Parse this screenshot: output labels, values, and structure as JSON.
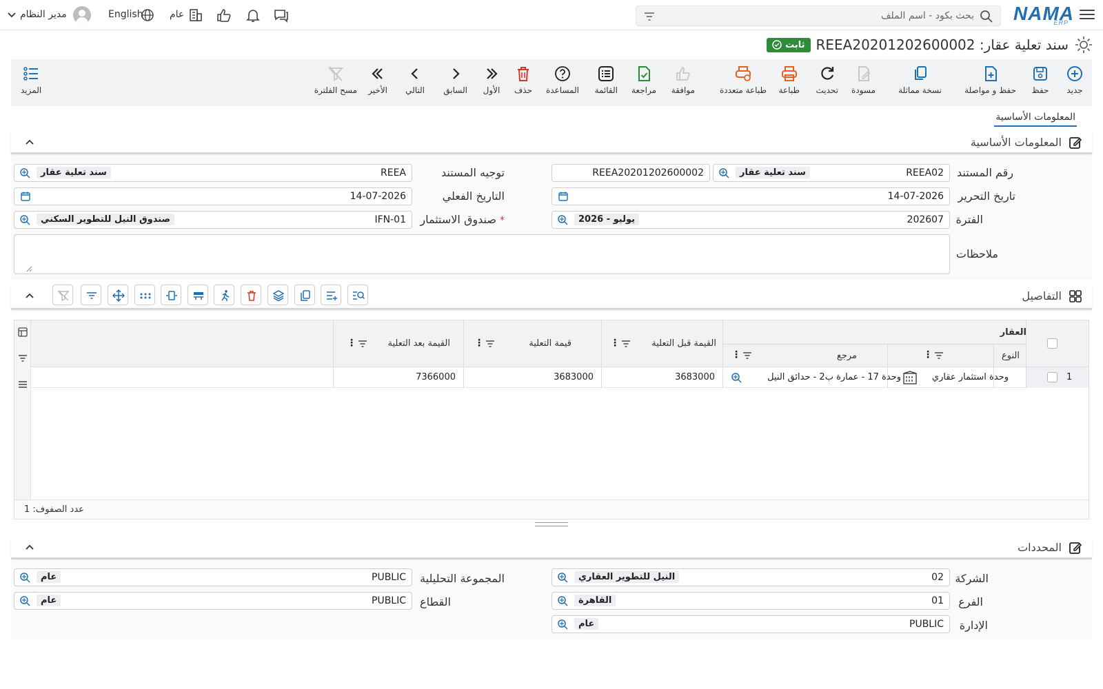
{
  "topbar": {
    "logo": "NAMA",
    "logo_sub": "ERP",
    "search_placeholder": "بحث بكود - اسم الملف",
    "user": "مدير النظام",
    "language": "English",
    "branch": "عام"
  },
  "header": {
    "title": "سند تعلية عقار: REEA20201202600002",
    "status": "ثابت"
  },
  "toolbar": {
    "new": "جديد",
    "save": "حفظ",
    "save_continue": "حفظ و مواصلة",
    "duplicate": "نسخة مماثلة",
    "draft": "مسودة",
    "refresh": "تحديث",
    "print": "طباعة",
    "multi_print": "طباعة متعددة",
    "approve": "موافقة",
    "review": "مراجعة",
    "list": "القائمة",
    "help": "المساعدة",
    "delete": "حذف",
    "first": "الأول",
    "previous": "السابق",
    "next": "التالي",
    "last": "الأخير",
    "clear_filter": "مسح الفلترة",
    "more": "المزيد"
  },
  "tabs": [
    "المعلومات الأساسية"
  ],
  "basic": {
    "section_title": "المعلومات الأساسية",
    "doc_number_label": "رقم المستند",
    "doc_number_code": "REEA02",
    "doc_number_tag": "سند تعلية عقار",
    "doc_number_full": "REEA20201202600002",
    "direction_label": "توجيه المستند",
    "direction_code": "REEA",
    "direction_tag": "سند تعلية عقار",
    "edit_date_label": "تاريخ التحرير",
    "edit_date": "14-07-2026",
    "actual_date_label": "التاريخ الفعلي",
    "actual_date": "14-07-2026",
    "period_label": "الفترة",
    "period_code": "202607",
    "period_tag": "2026 - يوليو",
    "fund_label": "صندوق الاستثمار",
    "fund_required": "*",
    "fund_code": "IFN-01",
    "fund_tag": "صندوق النيل للتطوير السكني",
    "notes_label": "ملاحظات"
  },
  "details": {
    "section_title": "التفاصيل",
    "group_header": "العقار",
    "columns": {
      "type": "النوع",
      "ref": "مرجع",
      "before": "القيمة قبل التعلية",
      "raise": "قيمة التعلية",
      "after": "القيمة بعد التعلية"
    },
    "rows": [
      {
        "num": "1",
        "type": "وحدة استثمار عقاري",
        "ref": "وحدة 17 - عمارة ب2 - حدائق النيل",
        "before": "3683000",
        "raise": "3683000",
        "after": "7366000"
      }
    ],
    "row_count": "عدد الصفوف: 1"
  },
  "dimensions": {
    "section_title": "المحددات",
    "company_label": "الشركة",
    "company_code": "02",
    "company_tag": "النيل للتطوير العقاري",
    "branch_label": "الفرع",
    "branch_code": "01",
    "branch_tag": "القاهرة",
    "dept_label": "الإدارة",
    "dept_code": "PUBLIC",
    "dept_tag": "عام",
    "analytic_label": "المجموعة التحليلية",
    "analytic_code": "PUBLIC",
    "analytic_tag": "عام",
    "sector_label": "القطاع",
    "sector_code": "PUBLIC",
    "sector_tag": "عام"
  },
  "colors": {
    "brand": "#1f6fb2",
    "success": "#2e8b3a",
    "danger": "#d9342b",
    "print": "#e8601c"
  }
}
